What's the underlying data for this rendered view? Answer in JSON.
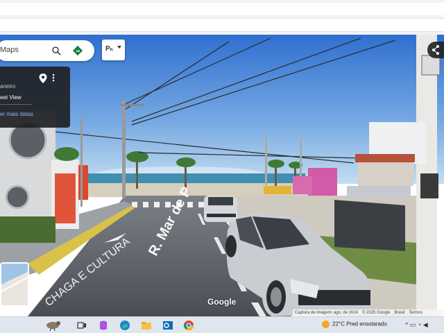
{
  "maps": {
    "search_text": "Maps",
    "search_icon": "search-icon",
    "directions_icon": "directions-icon",
    "pegman_label": "Pₙ"
  },
  "info_panel": {
    "location": "aneiro",
    "street_view": "eet View",
    "more_dates": "er mais datas"
  },
  "footer": {
    "capture": "Captura de imagem: ago. de 2024",
    "copyright": "© 2025 Google",
    "brasil": "Brasil",
    "terms": "Termos"
  },
  "street_sign": "R. Mar de P",
  "road_text": "CHAGA E CULTURA",
  "google_logo": "Google",
  "taskbar": {
    "weather_temp": "22°C",
    "weather_desc": "Pred ensolarado",
    "apps": [
      "widgets-icon",
      "task-view-icon",
      "copilot-icon",
      "edge-icon",
      "file-explorer-icon",
      "outlook-icon",
      "chrome-icon"
    ]
  },
  "colors": {
    "sky_top": "#3b78d6",
    "sky_bottom": "#a8cde8",
    "sea": "#3f8fb0",
    "road": "#5b5f66",
    "car": "#c9ccd1",
    "accent_green": "#1a73e8"
  }
}
